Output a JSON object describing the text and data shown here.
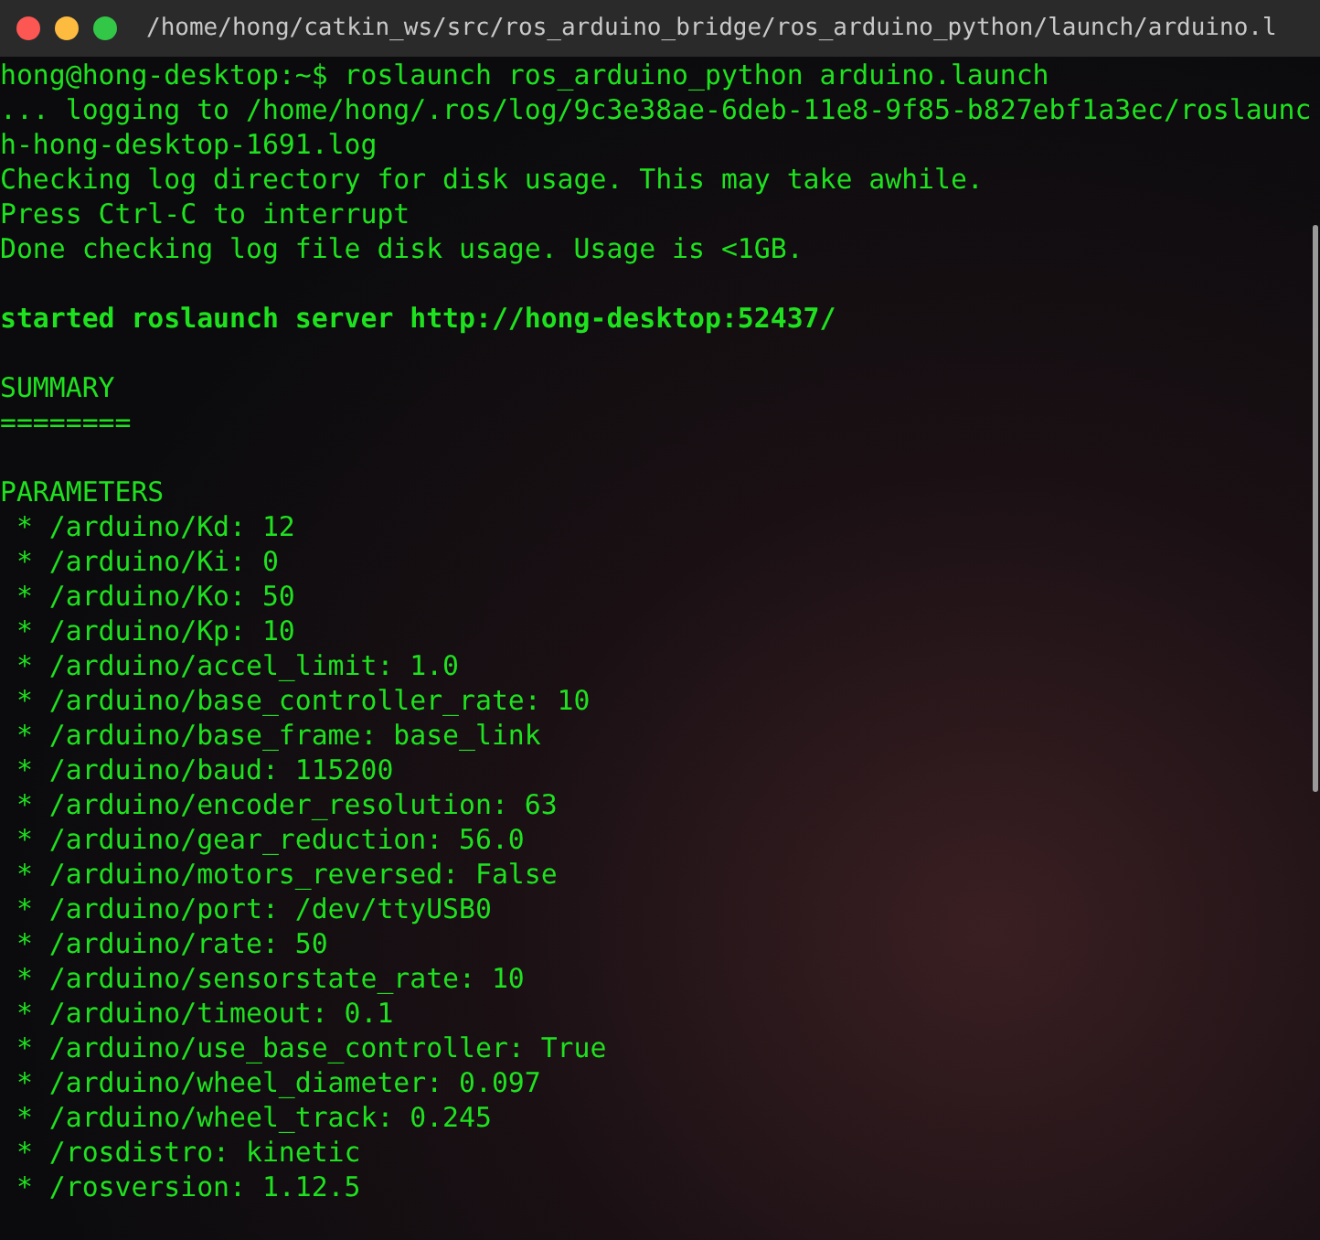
{
  "window": {
    "title": "/home/hong/catkin_ws/src/ros_arduino_bridge/ros_arduino_python/launch/arduino.l"
  },
  "terminal": {
    "lines": [
      {
        "kind": "normal",
        "text": "hong@hong-desktop:~$ roslaunch ros_arduino_python arduino.launch"
      },
      {
        "kind": "normal",
        "text": "... logging to /home/hong/.ros/log/9c3e38ae-6deb-11e8-9f85-b827ebf1a3ec/roslaunc"
      },
      {
        "kind": "normal",
        "text": "h-hong-desktop-1691.log"
      },
      {
        "kind": "normal",
        "text": "Checking log directory for disk usage. This may take awhile."
      },
      {
        "kind": "normal",
        "text": "Press Ctrl-C to interrupt"
      },
      {
        "kind": "normal",
        "text": "Done checking log file disk usage. Usage is <1GB."
      },
      {
        "kind": "blank"
      },
      {
        "kind": "bold",
        "text": "started roslaunch server http://hong-desktop:52437/"
      },
      {
        "kind": "blank"
      },
      {
        "kind": "normal",
        "text": "SUMMARY"
      },
      {
        "kind": "normal",
        "text": "========"
      },
      {
        "kind": "blank"
      },
      {
        "kind": "normal",
        "text": "PARAMETERS"
      },
      {
        "kind": "normal",
        "text": " * /arduino/Kd: 12"
      },
      {
        "kind": "normal",
        "text": " * /arduino/Ki: 0"
      },
      {
        "kind": "normal",
        "text": " * /arduino/Ko: 50"
      },
      {
        "kind": "normal",
        "text": " * /arduino/Kp: 10"
      },
      {
        "kind": "normal",
        "text": " * /arduino/accel_limit: 1.0"
      },
      {
        "kind": "normal",
        "text": " * /arduino/base_controller_rate: 10"
      },
      {
        "kind": "normal",
        "text": " * /arduino/base_frame: base_link"
      },
      {
        "kind": "normal",
        "text": " * /arduino/baud: 115200"
      },
      {
        "kind": "normal",
        "text": " * /arduino/encoder_resolution: 63"
      },
      {
        "kind": "normal",
        "text": " * /arduino/gear_reduction: 56.0"
      },
      {
        "kind": "normal",
        "text": " * /arduino/motors_reversed: False"
      },
      {
        "kind": "normal",
        "text": " * /arduino/port: /dev/ttyUSB0"
      },
      {
        "kind": "normal",
        "text": " * /arduino/rate: 50"
      },
      {
        "kind": "normal",
        "text": " * /arduino/sensorstate_rate: 10"
      },
      {
        "kind": "normal",
        "text": " * /arduino/timeout: 0.1"
      },
      {
        "kind": "normal",
        "text": " * /arduino/use_base_controller: True"
      },
      {
        "kind": "normal",
        "text": " * /arduino/wheel_diameter: 0.097"
      },
      {
        "kind": "normal",
        "text": " * /arduino/wheel_track: 0.245"
      },
      {
        "kind": "normal",
        "text": " * /rosdistro: kinetic"
      },
      {
        "kind": "normal",
        "text": " * /rosversion: 1.12.5"
      }
    ]
  }
}
